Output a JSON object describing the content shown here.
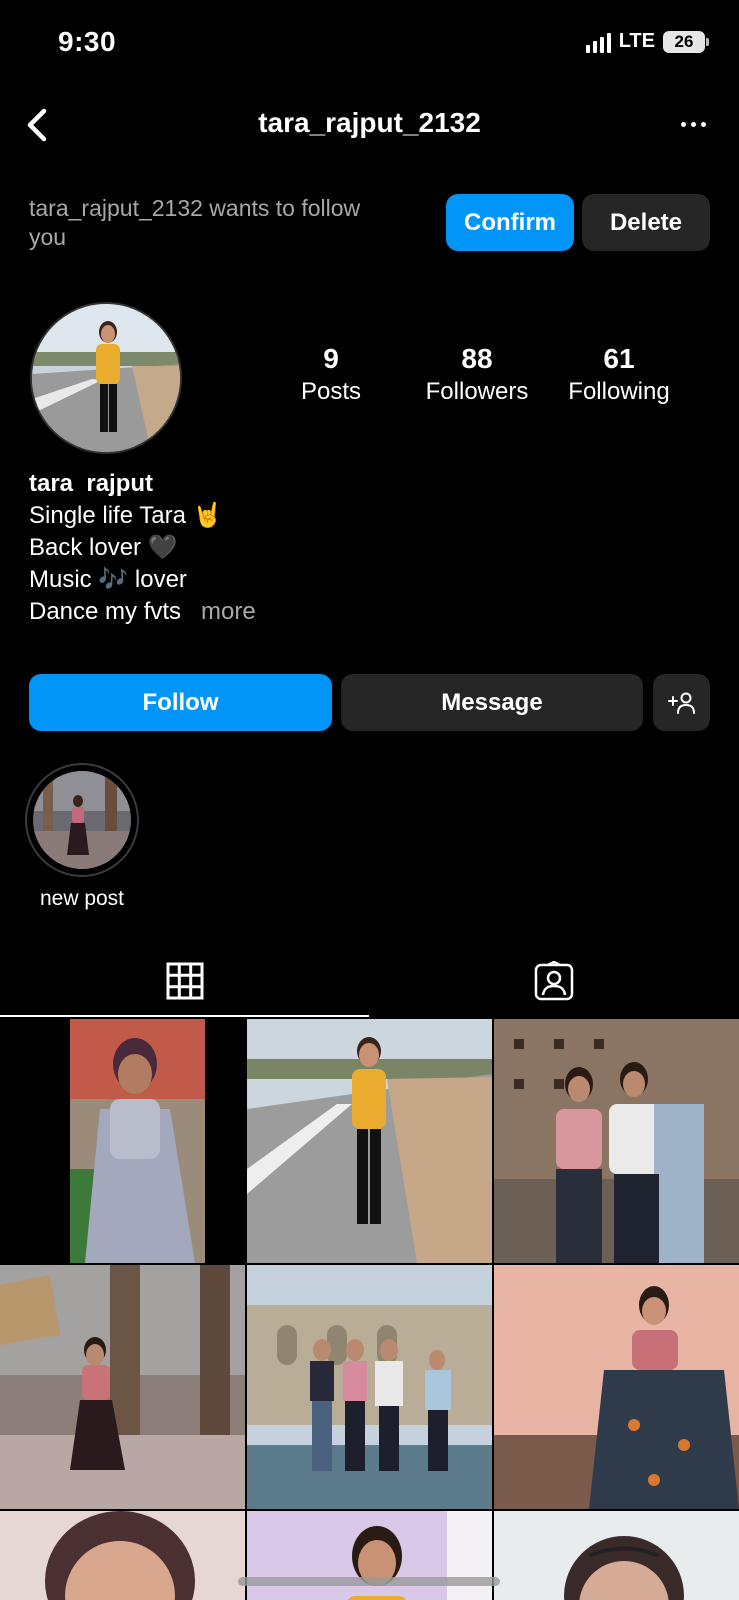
{
  "status_bar": {
    "time": "9:30",
    "network": "LTE",
    "battery": "26"
  },
  "header": {
    "username": "tara_rajput_2132",
    "back_icon": "chevron-left-icon",
    "more_icon": "more-horizontal-icon"
  },
  "follow_request": {
    "message": "tara_rajput_2132 wants to follow you",
    "confirm_label": "Confirm",
    "delete_label": "Delete"
  },
  "profile": {
    "stats": [
      {
        "value": "9",
        "label": "Posts"
      },
      {
        "value": "88",
        "label": "Followers"
      },
      {
        "value": "61",
        "label": "Following"
      }
    ],
    "name": "tara  rajput",
    "bio_lines": [
      "Single life Tara 🤘",
      "Back lover 🖤",
      "Music 🎶 lover",
      "Dance my fvts"
    ],
    "more_label": "more"
  },
  "actions": {
    "follow_label": "Follow",
    "message_label": "Message",
    "suggest_icon": "add-person-icon"
  },
  "highlights": [
    {
      "label": "new post"
    }
  ],
  "tabs": [
    {
      "name": "grid",
      "icon": "grid-icon",
      "active": true
    },
    {
      "name": "tagged",
      "icon": "tagged-person-icon",
      "active": false
    }
  ],
  "colors": {
    "background": "#000000",
    "primary_button": "#0095f6",
    "secondary_button": "#262626",
    "muted_text": "#a8a8a8"
  }
}
